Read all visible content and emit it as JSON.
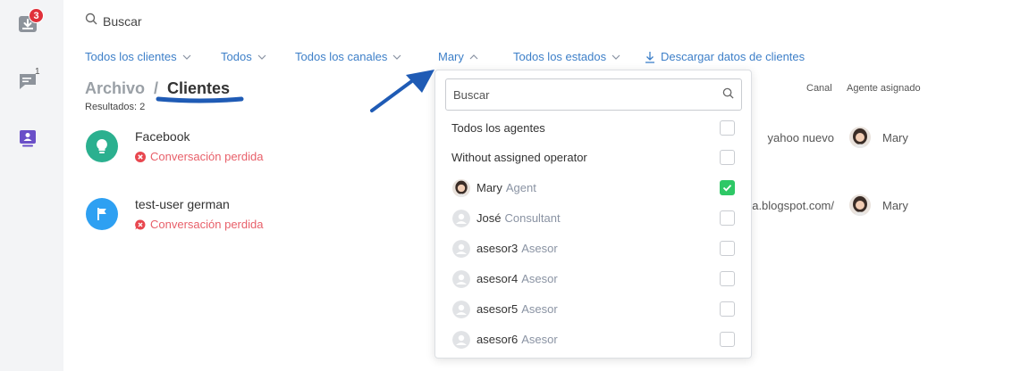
{
  "sidebar": {
    "inbox_badge": "3",
    "chat_badge": "1"
  },
  "search": {
    "label": "Buscar"
  },
  "filters": {
    "clients": "Todos los clientes",
    "all": "Todos",
    "channels": "Todos los canales",
    "agent": "Mary",
    "states": "Todos los estados",
    "download": "Descargar datos de clientes"
  },
  "breadcrumb": {
    "parent": "Archivo",
    "separator": "/",
    "current": "Clientes"
  },
  "results": "Resultados: 2",
  "columns": {
    "canal": "Canal",
    "agent": "Agente asignado"
  },
  "rows": [
    {
      "name": "Facebook",
      "status": "Conversación perdida",
      "canal": "yahoo nuevo",
      "agent": "Mary"
    },
    {
      "name": "test-user german",
      "status": "Conversación perdida",
      "canal": "a.blogspot.com/",
      "agent": "Mary"
    }
  ],
  "dropdown": {
    "search_placeholder": "Buscar",
    "all_agents": "Todos los agentes",
    "without_operator": "Without assigned operator",
    "agents": [
      {
        "name": "Mary",
        "role": "Agent",
        "checked": true
      },
      {
        "name": "José",
        "role": "Consultant",
        "checked": false
      },
      {
        "name": "asesor3",
        "role": "Asesor",
        "checked": false
      },
      {
        "name": "asesor4",
        "role": "Asesor",
        "checked": false
      },
      {
        "name": "asesor5",
        "role": "Asesor",
        "checked": false
      },
      {
        "name": "asesor6",
        "role": "Asesor",
        "checked": false
      }
    ]
  },
  "colors": {
    "link": "#3d7fc8",
    "lost": "#e8606a",
    "checked": "#2ec866",
    "badge": "#e0303a",
    "annotation": "#1f5bb5"
  }
}
